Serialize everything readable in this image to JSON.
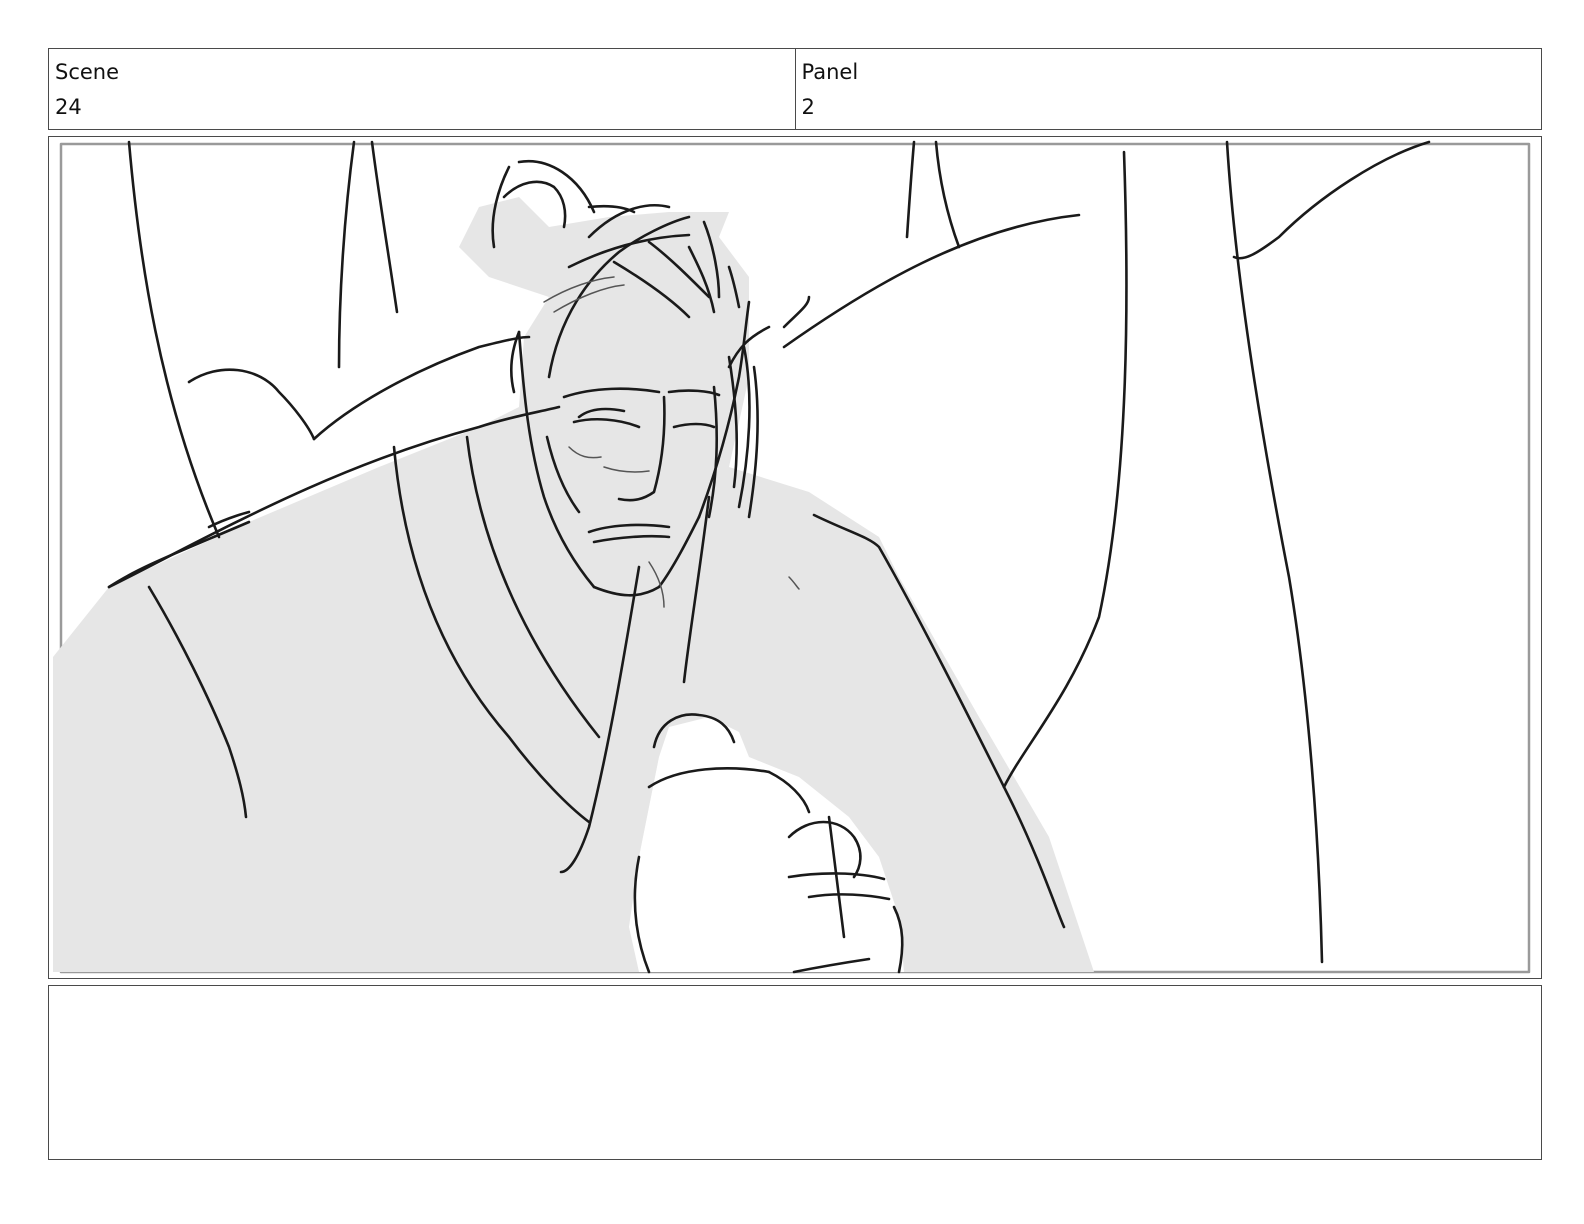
{
  "header": {
    "scene_label": "Scene",
    "scene_value": "24",
    "panel_label": "Panel",
    "panel_value": "2"
  },
  "panel": {
    "sketch": "samurai-sketch-icon",
    "fill_color": "#e6e6e6",
    "line_color": "#1a1a1a",
    "frame_color": "#9a9a9a"
  },
  "notes": {
    "text": ""
  }
}
